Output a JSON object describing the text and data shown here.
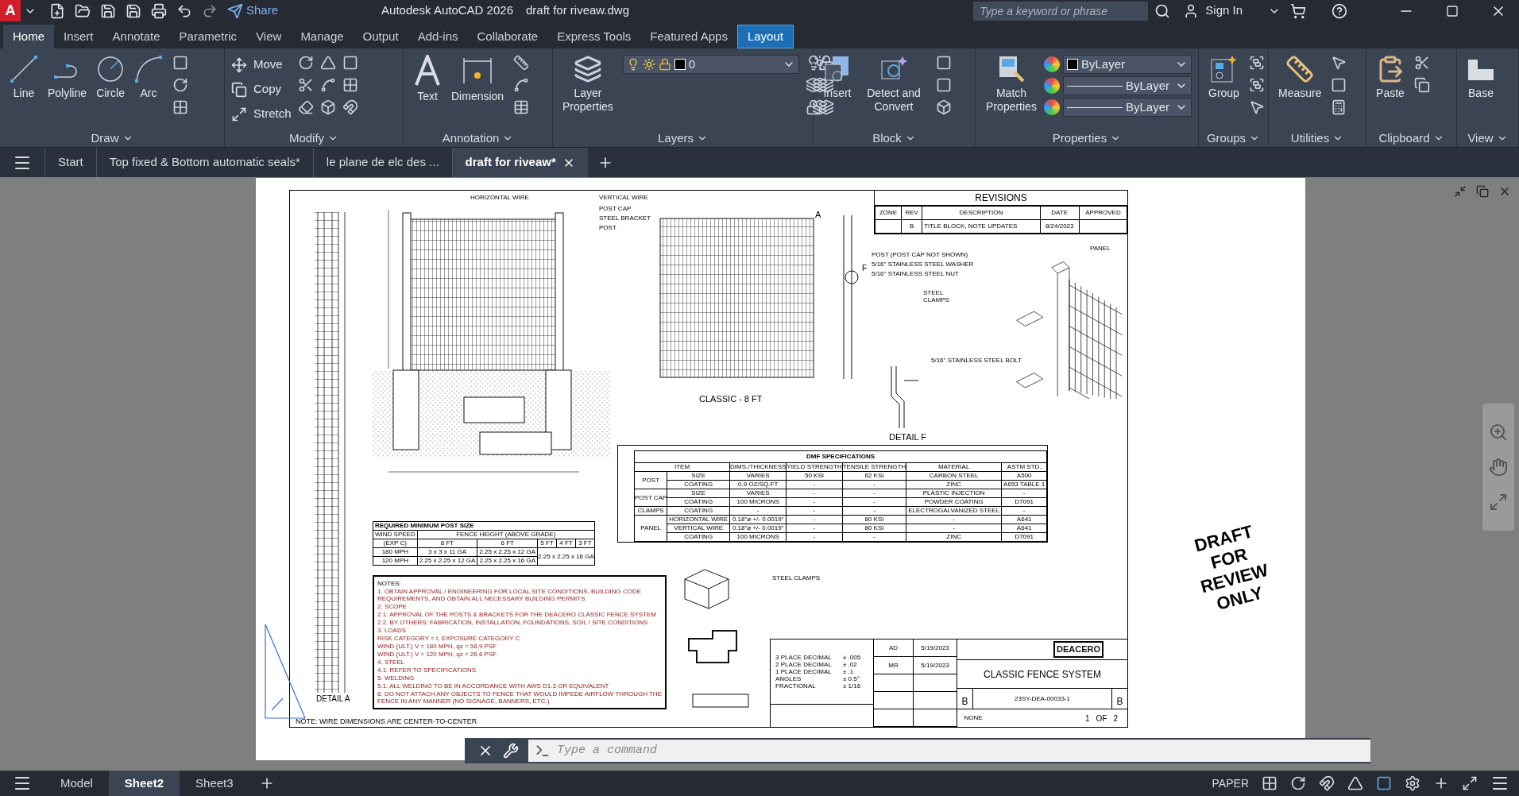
{
  "title_bar": {
    "logo": "A",
    "share": "Share",
    "app_title": "Autodesk AutoCAD 2026",
    "file_name": "draft for riveaw.dwg",
    "search": {
      "placeholder": "Type a keyword or phrase"
    },
    "sign_in": "Sign In"
  },
  "ribbon_tabs": [
    {
      "label": "Home",
      "selected": true
    },
    {
      "label": "Insert",
      "selected": false
    },
    {
      "label": "Annotate",
      "selected": false
    },
    {
      "label": "Parametric",
      "selected": false
    },
    {
      "label": "View",
      "selected": false
    },
    {
      "label": "Manage",
      "selected": false
    },
    {
      "label": "Output",
      "selected": false
    },
    {
      "label": "Add-ins",
      "selected": false
    },
    {
      "label": "Collaborate",
      "selected": false
    },
    {
      "label": "Express Tools",
      "selected": false
    },
    {
      "label": "Featured Apps",
      "selected": false
    },
    {
      "label": "Layout",
      "selected": false,
      "kind": "contextual"
    }
  ],
  "ribbon_panels": [
    {
      "title": "Draw",
      "tools": [
        {
          "label": "Line",
          "kind": "large"
        },
        {
          "label": "Polyline",
          "kind": "large"
        },
        {
          "label": "Circle",
          "kind": "large"
        },
        {
          "label": "Arc",
          "kind": "large"
        }
      ]
    },
    {
      "title": "Modify",
      "tools": [
        {
          "label": "Move",
          "kind": "small"
        },
        {
          "label": "Copy",
          "kind": "small"
        },
        {
          "label": "Stretch",
          "kind": "small"
        }
      ]
    },
    {
      "title": "Annotation",
      "tools": [
        {
          "label": "Text",
          "kind": "large"
        },
        {
          "label": "Dimension",
          "kind": "large"
        }
      ]
    },
    {
      "title": "Layers",
      "tools": [
        {
          "label": "Layer Properties",
          "kind": "large"
        }
      ],
      "layer": "0"
    },
    {
      "title": "Block",
      "tools": [
        {
          "label": "Insert",
          "kind": "large"
        },
        {
          "label": "Detect and Convert",
          "kind": "large"
        }
      ]
    },
    {
      "title": "Properties",
      "tools": [
        {
          "label": "Match Properties",
          "kind": "large"
        }
      ],
      "dropdowns": [
        "ByLayer",
        "ByLayer",
        "ByLayer"
      ]
    },
    {
      "title": "Groups",
      "tools": [
        {
          "label": "Group",
          "kind": "large"
        }
      ]
    },
    {
      "title": "Utilities",
      "tools": [
        {
          "label": "Measure",
          "kind": "large"
        }
      ]
    },
    {
      "title": "Clipboard",
      "tools": [
        {
          "label": "Paste",
          "kind": "large"
        }
      ]
    },
    {
      "title": "View",
      "tools": [
        {
          "label": "Base",
          "kind": "large"
        }
      ]
    }
  ],
  "doc_tabs": [
    {
      "label": "Start",
      "selected": false
    },
    {
      "label": "Top fixed & Bottom automatic seals*",
      "selected": false
    },
    {
      "label": "le plane de elc des ...",
      "selected": false
    },
    {
      "label": "draft for riveaw*",
      "selected": true
    }
  ],
  "sheet": {
    "revisions": {
      "title": "REVISIONS",
      "columns": [
        "ZONE",
        "REV",
        "DESCRIPTION",
        "DATE",
        "APPROVED"
      ],
      "rows": [
        [
          "",
          "B",
          "TITLE BLOCK, NOTE UPDATES",
          "8/24/2023",
          ""
        ]
      ]
    },
    "fence_labels": [
      "HORIZONTAL WIRE",
      "VERTICAL WIRE",
      "POST CAP",
      "STEEL BRACKET",
      "POST"
    ],
    "panel_label": "CLASSIC - 8 FT",
    "panel_marker": "A",
    "detail_f_marker": "F",
    "detail_f_label": "DETAIL F",
    "detail_a_label": "DETAIL A",
    "iso_labels": [
      "POST (POST CAP NOT SHOWN)",
      "5/16\" STAINLESS STEEL WASHER",
      "5/16\" STAINLESS STEEL NUT",
      "STEEL CLAMPS",
      "5/16\" STAINLESS STEEL BOLT",
      "PANEL"
    ],
    "clamp_label": "STEEL CLAMPS",
    "specs": {
      "title": "DMF SPECIFICATIONS",
      "columns": [
        "ITEM",
        "DIMS./THICKNESS",
        "YIELD STRENGTH",
        "TENSILE STRENGTH",
        "MATERIAL",
        "ASTM STD."
      ],
      "groups": [
        {
          "item": "POST",
          "rows": [
            [
              "SIZE",
              "VARIES",
              "50 KSI",
              "62 KSI",
              "CARBON STEEL",
              "A500"
            ],
            [
              "COATING",
              "0.9 OZ/SQ.FT",
              "-",
              "-",
              "ZINC",
              "A653 TABLE 1"
            ]
          ]
        },
        {
          "item": "POST CAP",
          "rows": [
            [
              "SIZE",
              "VARIES",
              "-",
              "-",
              "PLASTIC INJECTION",
              "-"
            ],
            [
              "COATING",
              "100 MICRONS",
              "-",
              "-",
              "POWDER COATING",
              "D7091"
            ]
          ]
        },
        {
          "item": "CLAMPS",
          "rows": [
            [
              "COATING",
              "-",
              "-",
              "-",
              "ELECTROGALVANIZED STEEL",
              "-"
            ]
          ]
        },
        {
          "item": "PANEL",
          "rows": [
            [
              "HORIZONTAL WIRE",
              "0.18\"ø +/- 0.0019\"",
              "-",
              "80 KSI",
              "-",
              "A641"
            ],
            [
              "VERTICAL WIRE",
              "0.18\"ø +/- 0.0019\"",
              "-",
              "80 KSI",
              "-",
              "A641"
            ],
            [
              "COATING",
              "100 MICRONS",
              "-",
              "-",
              "ZINC",
              "D7091"
            ]
          ]
        }
      ]
    },
    "post_size": {
      "title": "REQUIRED MINIMUM POST SIZE",
      "wind_speed": "WIND SPEED",
      "exposure": "(EXP C)",
      "height_header": "FENCE HEIGHT (ABOVE GRADE)",
      "heights": [
        "8 FT",
        "6 FT",
        "5 FT",
        "4 FT",
        "3 FT"
      ],
      "rows": [
        {
          "speed": "180 MPH",
          "sizes": [
            "3 x 3 x 11 GA",
            "2.25 x 2.25 x 12 GA"
          ]
        },
        {
          "speed": "120 MPH",
          "sizes": [
            "2.25 x 2.25 x 12 GA",
            "2.25 x 2.25 x 16 GA"
          ]
        }
      ],
      "shared": "2.25 x 2.25 x 16 GA"
    },
    "notes": {
      "title": "NOTES:",
      "lines": [
        "1.  OBTAIN APPROVAL / ENGINEERING FOR LOCAL SITE CONDITIONS, BUILDING CODE REQUIREMENTS, AND OBTAIN ALL NECESSARY BUILDING PERMITS",
        "2.  SCOPE",
        "2.1.  APPROVAL OF THE POSTS & BRACKETS FOR THE DEACERO CLASSIC FENCE SYSTEM",
        "2.2.  BY OTHERS: FABRICATION, INSTALLATION, FOUNDATIONS, SOIL / SITE CONDITIONS",
        "3.  LOADS",
        "RISK CATEGORY = I, EXPOSURE CATEGORY C",
        "WIND (ULT.) V = 180 MPH, qz = 58.9 PSF",
        "WIND (ULT.) V = 120 MPH, qz = 26.6 PSF",
        "4.  STEEL",
        "4.1.  REFER TO SPECIFICATIONS",
        "5.  WELDING",
        "5.1.  ALL WELDING TO BE IN ACCORDANCE WITH AWS D1.3 OR EQUIVALENT",
        "6.  DO NOT ATTACH ANY OBJECTS TO FENCE THAT WOULD IMPEDE AIRFLOW THROUGH THE FENCE IN ANY MANNER (NO SIGNAGE, BANNERS, ETC.)"
      ]
    },
    "wire_note": "NOTE: WIRE DIMENSIONS ARE CENTER-TO-CENTER",
    "stamp": [
      "DRAFT",
      "FOR",
      "REVIEW",
      "ONLY"
    ],
    "title_block": {
      "tolerances": [
        [
          "3 PLACE DECIMAL",
          "± .005"
        ],
        [
          "2 PLACE DECIMAL",
          "± .02"
        ],
        [
          "1 PLACE DECIMAL",
          "± .1"
        ],
        [
          "ANGLES",
          "± 0.5°"
        ],
        [
          "FRACTIONAL",
          "± 1/16"
        ]
      ],
      "signoffs": [
        [
          "AD",
          "5/19/2023"
        ],
        [
          "MR",
          "5/19/2023"
        ]
      ],
      "company": "DEACERO",
      "title": "CLASSIC FENCE SYSTEM",
      "size": "B",
      "drawing_number": "23SY-DEA-00033-1",
      "rev": "B",
      "scale": "NONE",
      "sheet": "1",
      "of": "OF",
      "total": "2"
    }
  },
  "command_line": {
    "placeholder": "Type a command"
  },
  "layout_tabs": [
    {
      "label": "Model",
      "selected": false
    },
    {
      "label": "Sheet2",
      "selected": true
    },
    {
      "label": "Sheet3",
      "selected": false
    }
  ],
  "status_bar": {
    "space": "PAPER"
  }
}
